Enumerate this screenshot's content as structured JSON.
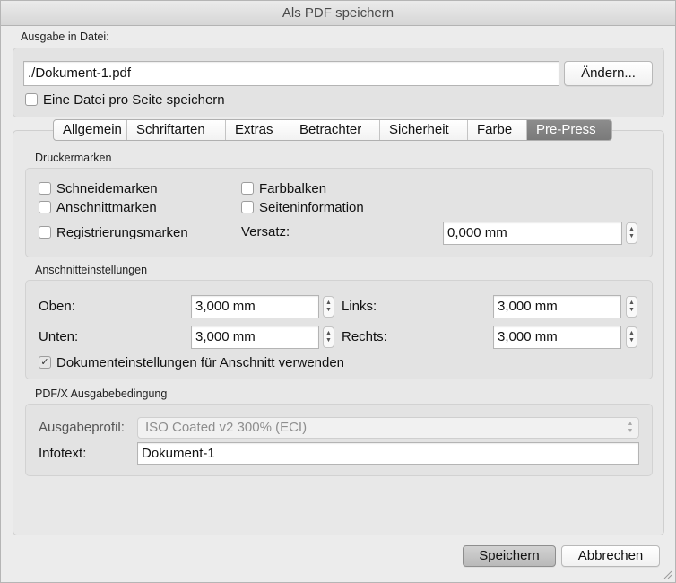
{
  "window": {
    "title": "Als PDF speichern"
  },
  "output": {
    "label": "Ausgabe in Datei:",
    "path": "./Dokument-1.pdf",
    "change_button": "Ändern...",
    "one_file_per_page": {
      "label": "Eine Datei pro Seite speichern",
      "checked": false
    }
  },
  "tabs": [
    {
      "label": "Allgemein",
      "active": false
    },
    {
      "label": "Schriftarten",
      "active": false
    },
    {
      "label": "Extras",
      "active": false
    },
    {
      "label": "Betrachter",
      "active": false
    },
    {
      "label": "Sicherheit",
      "active": false
    },
    {
      "label": "Farbe",
      "active": false
    },
    {
      "label": "Pre-Press",
      "active": true
    }
  ],
  "printer_marks": {
    "heading": "Druckermarken",
    "crop_marks": {
      "label": "Schneidemarken",
      "checked": false
    },
    "bleed_marks": {
      "label": "Anschnittmarken",
      "checked": false
    },
    "registration_marks": {
      "label": "Registrierungsmarken",
      "checked": false
    },
    "color_bars": {
      "label": "Farbbalken",
      "checked": false
    },
    "page_info": {
      "label": "Seiteninformation",
      "checked": false
    },
    "offset": {
      "label": "Versatz:",
      "value": "0,000 mm"
    }
  },
  "bleed": {
    "heading": "Anschnitteinstellungen",
    "top": {
      "label": "Oben:",
      "value": "3,000 mm"
    },
    "bottom": {
      "label": "Unten:",
      "value": "3,000 mm"
    },
    "left": {
      "label": "Links:",
      "value": "3,000 mm"
    },
    "right": {
      "label": "Rechts:",
      "value": "3,000 mm"
    },
    "use_document": {
      "label": "Dokumenteinstellungen für Anschnitt verwenden",
      "checked": true
    }
  },
  "pdfx": {
    "heading": "PDF/X Ausgabebedingung",
    "profile": {
      "label": "Ausgabeprofil:",
      "value": "ISO Coated v2 300% (ECI)",
      "enabled": false
    },
    "info": {
      "label": "Infotext:",
      "value": "Dokument-1"
    }
  },
  "actions": {
    "save": "Speichern",
    "cancel": "Abbrechen"
  }
}
